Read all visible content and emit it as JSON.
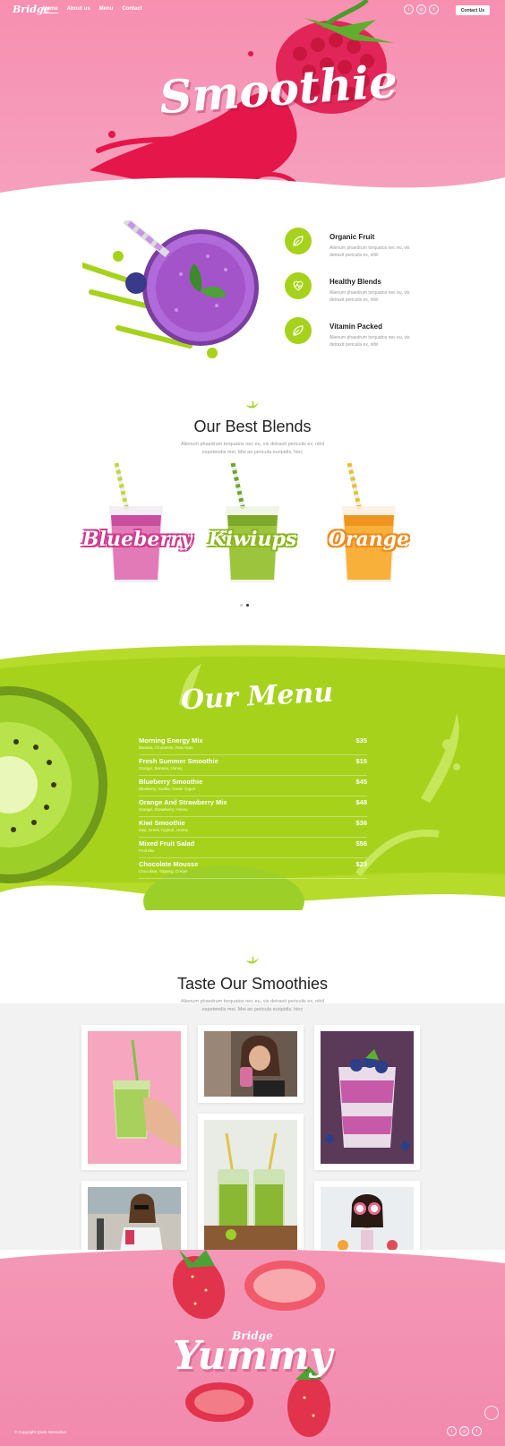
{
  "header": {
    "logo": "Bridge",
    "nav": [
      "Home",
      "About us",
      "Menu",
      "Contact"
    ],
    "social_icons": [
      "twitter-icon",
      "instagram-icon",
      "facebook-icon"
    ],
    "social_glyphs": [
      "t",
      "◎",
      "f"
    ],
    "contact_button": "Contact Us"
  },
  "hero": {
    "title": "Smoothie"
  },
  "features": [
    {
      "icon": "leaf-icon",
      "title": "Organic Fruit",
      "desc": "Alienum phaedrum torquatos nec eu, vis detraxit periculis ex, nihil"
    },
    {
      "icon": "heart-icon",
      "title": "Healthy Blends",
      "desc": "Alienum phaedrum torquatos nec eu, vis detraxit periculis ex, nihil"
    },
    {
      "icon": "leaf-icon",
      "title": "Vitamin Packed",
      "desc": "Alienum phaedrum torquatos nec eu, vis detraxit periculis ex, nihil"
    }
  ],
  "blends": {
    "title": "Our Best Blends",
    "desc_line1": "Alienum phaedrum torquatos nec eu, vis detraxit periculis ex, nihil",
    "desc_line2": "expetendis mei. Mei an pericula euripidis, hinc",
    "items": [
      {
        "name": "Blueberry",
        "color": "#d23a8e"
      },
      {
        "name": "Kiwiups",
        "color": "#8cb61e"
      },
      {
        "name": "Orange",
        "color": "#ef8a1c"
      }
    ]
  },
  "menu": {
    "title": "Our Menu",
    "items": [
      {
        "name": "Morning Energy Mix",
        "sub": "Banana, Cinnamon, Raw Nuts",
        "price": "$35"
      },
      {
        "name": "Fresh Summer Smoothie",
        "sub": "Orange, Banana, Honey",
        "price": "$15"
      },
      {
        "name": "Blueberry Smoothie",
        "sub": "Blueberry, Vanilla, Greek Yogurt",
        "price": "$45"
      },
      {
        "name": "Orange And Strawberry Mix",
        "sub": "Orange, Strawberry, Honey",
        "price": "$48"
      },
      {
        "name": "Kiwi Smoothie",
        "sub": "Kiwi, Greek Yoghurt, Honey",
        "price": "$36"
      },
      {
        "name": "Mixed Fruit Salad",
        "sub": "Fruit Mix",
        "price": "$56"
      },
      {
        "name": "Chocolate Mousse",
        "sub": "Chocolate, Topping, Cream",
        "price": "$23"
      }
    ]
  },
  "taste": {
    "title": "Taste Our Smoothies",
    "desc_line1": "Alienum phaedrum torquatos nec eu, vis detraxit periculis ex, nihil",
    "desc_line2": "expetendis mei. Mei an pericula euripidis, hinc"
  },
  "footer": {
    "bridge": "Bridge",
    "yummy": "Yummy",
    "copyright": "© Copyright Qode Interactive",
    "social_icons": [
      "twitter-icon",
      "instagram-icon",
      "facebook-icon"
    ],
    "social_glyphs": [
      "t",
      "◎",
      "f"
    ]
  },
  "colors": {
    "pink": "#f78fb1",
    "lime": "#a6d21c",
    "purple": "#a354c9",
    "raspberry": "#e22558"
  }
}
